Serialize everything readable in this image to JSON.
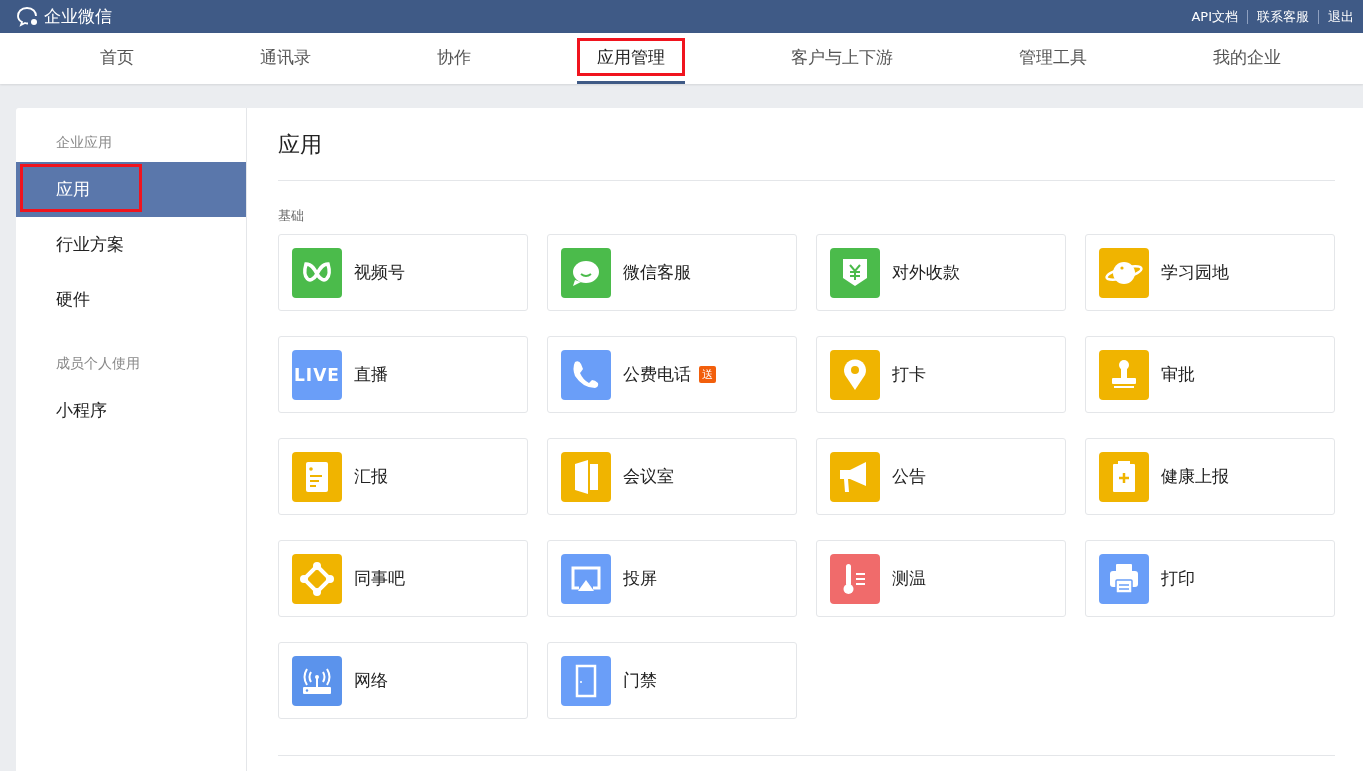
{
  "topbar": {
    "logo": "企业微信",
    "links": [
      "API文档",
      "联系客服",
      "退出"
    ]
  },
  "tabs": [
    {
      "label": "首页",
      "selected": false,
      "annotated": false
    },
    {
      "label": "通讯录",
      "selected": false,
      "annotated": false
    },
    {
      "label": "协作",
      "selected": false,
      "annotated": false
    },
    {
      "label": "应用管理",
      "selected": true,
      "annotated": true
    },
    {
      "label": "客户与上下游",
      "selected": false,
      "annotated": false
    },
    {
      "label": "管理工具",
      "selected": false,
      "annotated": false
    },
    {
      "label": "我的企业",
      "selected": false,
      "annotated": false
    }
  ],
  "sidebar": {
    "groups": [
      {
        "heading": "企业应用",
        "items": [
          {
            "label": "应用",
            "selected": true,
            "annotated": true
          },
          {
            "label": "行业方案",
            "selected": false,
            "annotated": false
          },
          {
            "label": "硬件",
            "selected": false,
            "annotated": false
          }
        ]
      },
      {
        "heading": "成员个人使用",
        "items": [
          {
            "label": "小程序",
            "selected": false,
            "annotated": false
          }
        ]
      }
    ]
  },
  "content": {
    "title": "应用",
    "section": "基础",
    "apps": [
      {
        "name": "视频号",
        "color": "#4bbb4b"
      },
      {
        "name": "微信客服",
        "color": "#4bbb4b"
      },
      {
        "name": "对外收款",
        "color": "#4bbb4b"
      },
      {
        "name": "学习园地",
        "color": "#f0b400"
      },
      {
        "name": "直播",
        "color": "#6a9ef8",
        "icon_text": "LIVE"
      },
      {
        "name": "公费电话",
        "color": "#6a9ef8",
        "badge": "送"
      },
      {
        "name": "打卡",
        "color": "#f0b400"
      },
      {
        "name": "审批",
        "color": "#f0b400"
      },
      {
        "name": "汇报",
        "color": "#f0b400"
      },
      {
        "name": "会议室",
        "color": "#f0b400"
      },
      {
        "name": "公告",
        "color": "#f0b400"
      },
      {
        "name": "健康上报",
        "color": "#f0b400"
      },
      {
        "name": "同事吧",
        "color": "#f0b400"
      },
      {
        "name": "投屏",
        "color": "#6a9ef8"
      },
      {
        "name": "测温",
        "color": "#f06b6b"
      },
      {
        "name": "打印",
        "color": "#6a9ef8"
      },
      {
        "name": "网络",
        "color": "#5b93ec"
      },
      {
        "name": "门禁",
        "color": "#6a9ef8"
      }
    ]
  }
}
